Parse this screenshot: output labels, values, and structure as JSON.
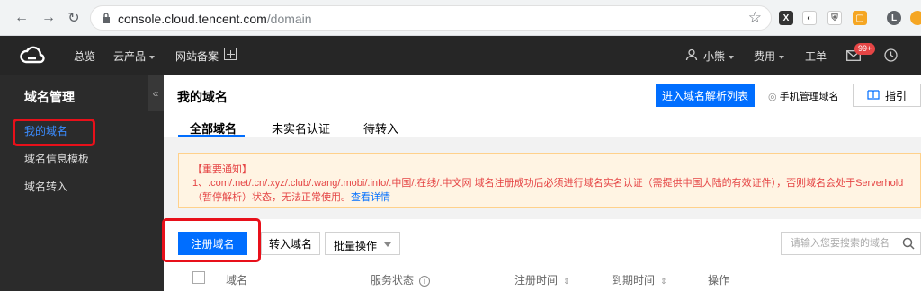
{
  "browser": {
    "url_host": "console.cloud.tencent.com",
    "url_path": "/domain",
    "extensions": [
      {
        "name": "x-ext-icon",
        "glyph": "X",
        "color": "#333"
      },
      {
        "name": "spy-ext-icon",
        "glyph": "◐",
        "color": "#444"
      },
      {
        "name": "shield-ext-icon",
        "glyph": "⛨",
        "color": "#666"
      },
      {
        "name": "orange-ext-icon",
        "glyph": "▢",
        "color": "#f5a623"
      },
      {
        "name": "profile-avatar",
        "glyph": "L",
        "color": "#5f6368"
      }
    ]
  },
  "topbar": {
    "overview": "总览",
    "products": "云产品",
    "icp": "网站备案",
    "user": "小熊",
    "billing": "费用",
    "ticket": "工单",
    "badge": "99+"
  },
  "sidebar": {
    "title": "域名管理",
    "collapse_glyph": "«",
    "items": [
      {
        "label": "我的域名",
        "active": true
      },
      {
        "label": "域名信息模板",
        "active": false
      },
      {
        "label": "域名转入",
        "active": false
      }
    ]
  },
  "main": {
    "title": "我的域名",
    "dns_list_button": "进入域名解析列表",
    "mobile_manage": "手机管理域名",
    "guide": "指引",
    "tabs": [
      {
        "label": "全部域名",
        "active": true
      },
      {
        "label": "未实名认证",
        "active": false
      },
      {
        "label": "待转入",
        "active": false
      }
    ],
    "notice": {
      "title": "【重要通知】",
      "body": "1、.com/.net/.cn/.xyz/.club/.wang/.mobi/.info/.中国/.在线/.中文网 域名注册成功后必须进行域名实名认证（需提供中国大陆的有效证件），否则域名会处于Serverhold（暂停解析）状态，无法正常使用。",
      "link": "查看详情"
    },
    "register_button": "注册域名",
    "transfer_button": "转入域名",
    "batch_select": "批量操作",
    "search_placeholder": "请输入您要搜索的域名",
    "table_headers": {
      "domain": "域名",
      "status": "服务状态",
      "reg_time": "注册时间",
      "exp_time": "到期时间",
      "actions": "操作"
    }
  },
  "colors": {
    "accent": "#006eff",
    "highlight": "#e8101a",
    "notice_text": "#e54545"
  }
}
